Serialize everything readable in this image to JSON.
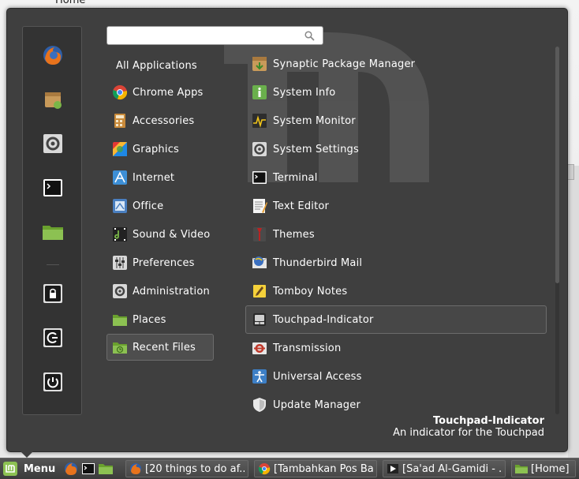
{
  "desktop": {
    "label": "Home"
  },
  "search": {
    "placeholder": "",
    "value": ""
  },
  "favorites": [
    {
      "name": "firefox-icon"
    },
    {
      "name": "software-package-icon"
    },
    {
      "name": "system-settings-icon"
    },
    {
      "name": "terminal-icon"
    },
    {
      "name": "folder-icon"
    },
    {
      "name": "lock-screen-icon"
    },
    {
      "name": "logout-icon"
    },
    {
      "name": "shutdown-icon"
    }
  ],
  "categories": [
    {
      "label": "All Applications",
      "icon": ""
    },
    {
      "label": "Chrome Apps",
      "icon": "chrome-icon"
    },
    {
      "label": "Accessories",
      "icon": "accessories-icon"
    },
    {
      "label": "Graphics",
      "icon": "graphics-icon"
    },
    {
      "label": "Internet",
      "icon": "internet-icon"
    },
    {
      "label": "Office",
      "icon": "office-icon"
    },
    {
      "label": "Sound & Video",
      "icon": "sound-video-icon"
    },
    {
      "label": "Preferences",
      "icon": "preferences-icon"
    },
    {
      "label": "Administration",
      "icon": "administration-icon"
    },
    {
      "label": "Places",
      "icon": "places-icon"
    },
    {
      "label": "Recent Files",
      "icon": "recent-files-icon"
    }
  ],
  "selected_category": "Recent Files",
  "apps": [
    {
      "label": "Synaptic Package Manager",
      "icon": "synaptic-icon"
    },
    {
      "label": "System Info",
      "icon": "system-info-icon"
    },
    {
      "label": "System Monitor",
      "icon": "system-monitor-icon"
    },
    {
      "label": "System Settings",
      "icon": "system-settings-icon"
    },
    {
      "label": "Terminal",
      "icon": "terminal-icon"
    },
    {
      "label": "Text Editor",
      "icon": "text-editor-icon"
    },
    {
      "label": "Themes",
      "icon": "themes-icon"
    },
    {
      "label": "Thunderbird Mail",
      "icon": "thunderbird-icon"
    },
    {
      "label": "Tomboy Notes",
      "icon": "tomboy-icon"
    },
    {
      "label": "Touchpad-Indicator",
      "icon": "touchpad-icon"
    },
    {
      "label": "Transmission",
      "icon": "transmission-icon"
    },
    {
      "label": "Universal Access",
      "icon": "universal-access-icon"
    },
    {
      "label": "Update Manager",
      "icon": "update-manager-icon"
    }
  ],
  "hovered_app": "Touchpad-Indicator",
  "description": {
    "name": "Touchpad-Indicator",
    "text": "An indicator for the Touchpad"
  },
  "panel": {
    "menu_label": "Menu",
    "tasks": [
      {
        "label": "[20 things to do af...",
        "icon": "firefox-icon"
      },
      {
        "label": "[Tambahkan Pos Ba...",
        "icon": "chrome-icon"
      },
      {
        "label": "[Sa'ad Al-Gamidi - ...",
        "icon": "video-player-icon"
      },
      {
        "label": "[Home]",
        "icon": "folder-icon"
      }
    ]
  },
  "colors": {
    "menu_bg": "#3f3f3f",
    "sidebar_bg": "#333333",
    "mint_green": "#8cc152",
    "panel_bg": "#444444"
  }
}
